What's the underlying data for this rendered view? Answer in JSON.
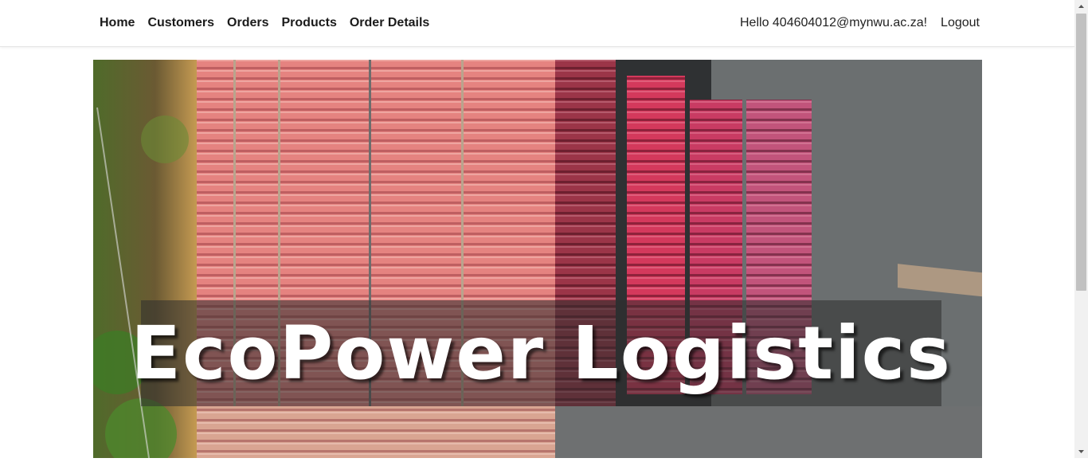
{
  "nav": {
    "links": [
      "Home",
      "Customers",
      "Orders",
      "Products",
      "Order Details"
    ],
    "greeting": "Hello 404604012@mynwu.ac.za!",
    "logout": "Logout"
  },
  "hero": {
    "brand": "EcoPower Logistics"
  },
  "colors": {
    "navbar_bg": "#ffffff",
    "nav_text": "#1b1b1b",
    "banner_overlay": "#2d2d2d",
    "brand_text": "#ffffff"
  }
}
